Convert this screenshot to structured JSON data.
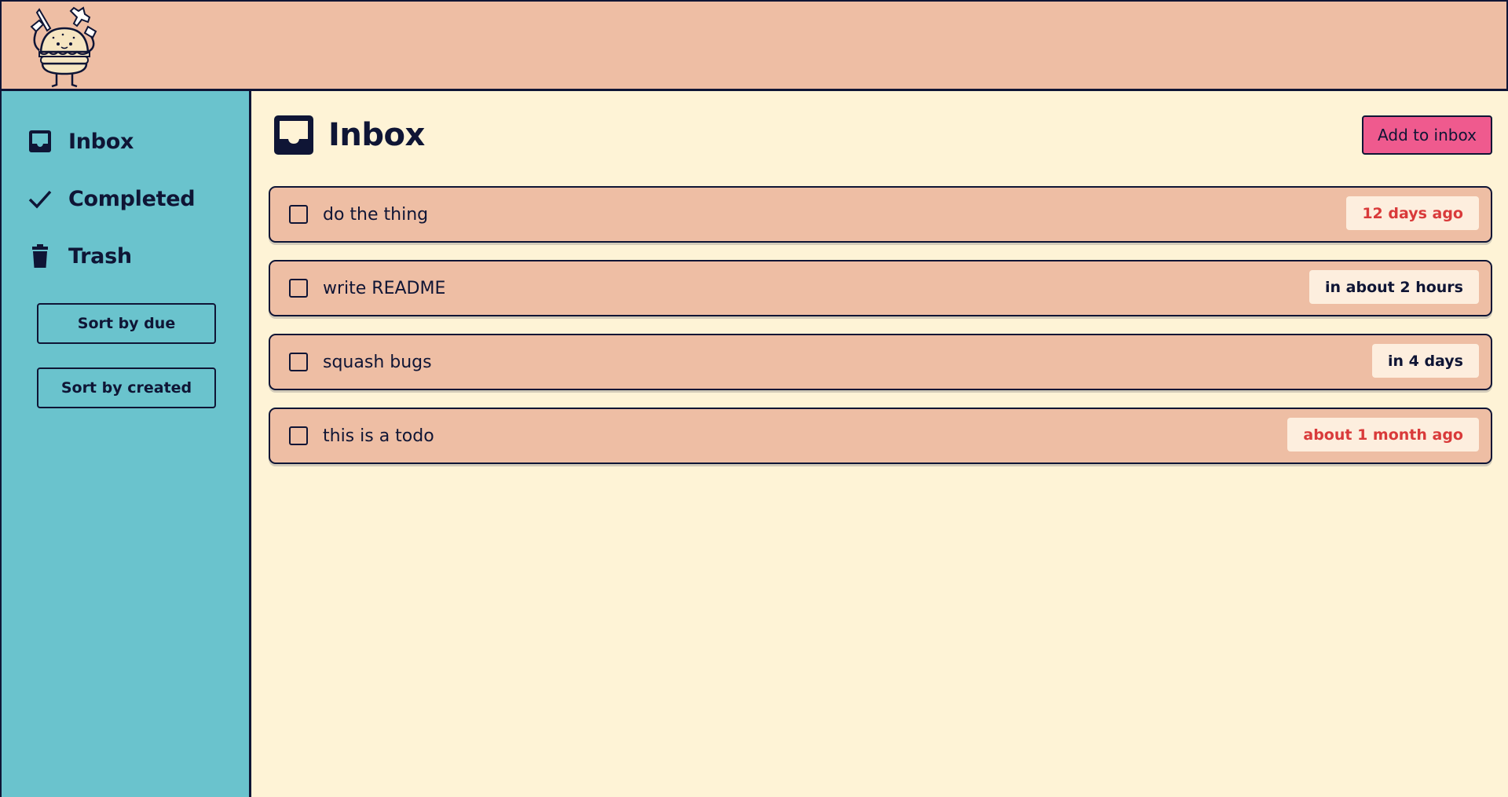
{
  "header": {
    "logo_icon": "burger-mascot-with-knife-and-fork"
  },
  "sidebar": {
    "items": [
      {
        "label": "Inbox",
        "icon": "inbox-icon"
      },
      {
        "label": "Completed",
        "icon": "check-icon"
      },
      {
        "label": "Trash",
        "icon": "trash-icon"
      }
    ],
    "sort_due_label": "Sort by due",
    "sort_created_label": "Sort by created"
  },
  "main": {
    "title": "Inbox",
    "title_icon": "inbox-icon",
    "add_label": "Add to inbox",
    "todos": [
      {
        "text": "do the thing",
        "due": "12 days ago",
        "overdue": true
      },
      {
        "text": "write README",
        "due": "in about 2 hours",
        "overdue": false
      },
      {
        "text": "squash bugs",
        "due": "in 4 days",
        "overdue": false
      },
      {
        "text": "this is a todo",
        "due": "about 1 month ago",
        "overdue": true
      }
    ]
  },
  "colors": {
    "header_bg": "#eebea4",
    "sidebar_bg": "#6ac3cd",
    "main_bg": "#fef3d6",
    "ink": "#0f1535",
    "accent_button": "#ef5a8e",
    "overdue_text": "#d93a3a",
    "badge_bg": "#fdeede"
  }
}
